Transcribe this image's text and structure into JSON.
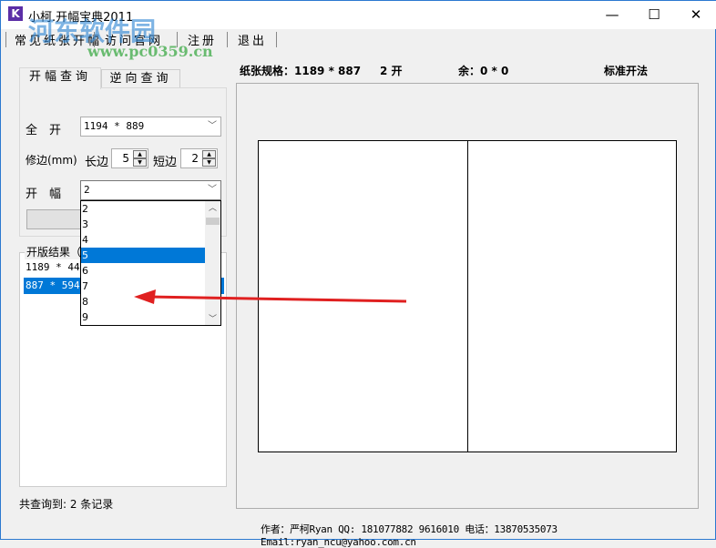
{
  "window": {
    "title": "小柯.开幅宝典2011",
    "minimize": "—",
    "maximize": "☐",
    "close": "✕"
  },
  "menu": [
    "常见纸张开幅",
    "访问官网",
    "注册",
    "退出"
  ],
  "tabs": [
    "开幅查询",
    "逆向查询"
  ],
  "form": {
    "full_label": "全　开",
    "full_value": "1194 * 889",
    "trim_label": "修边(mm)",
    "long_label": "长边",
    "long_value": "5",
    "short_label": "短边",
    "short_value": "2",
    "open_label": "开　幅",
    "open_value": "2"
  },
  "dropdown": {
    "options": [
      "2",
      "3",
      "4",
      "5",
      "6",
      "7",
      "8",
      "9"
    ],
    "highlighted": "5"
  },
  "results": {
    "title": "开版结果（",
    "items": [
      "1189 * 443",
      "887 * 594"
    ],
    "selected": "887 * 594"
  },
  "info": {
    "spec": "纸张规格：1189 * 887",
    "count": "2 开",
    "remain": "余：0 * 0",
    "method": "标准开法"
  },
  "status": "共查询到: 2 条记录",
  "author": "作者：严柯Ryan QQ: 181077882 9616010 电话：13870535073 Email:ryan_ncu@yahoo.com.cn",
  "watermark": {
    "name": "河东软件园",
    "url": "www.pc0359.cn"
  },
  "colors": {
    "highlight": "#0078d7",
    "arrow": "#e02020"
  }
}
